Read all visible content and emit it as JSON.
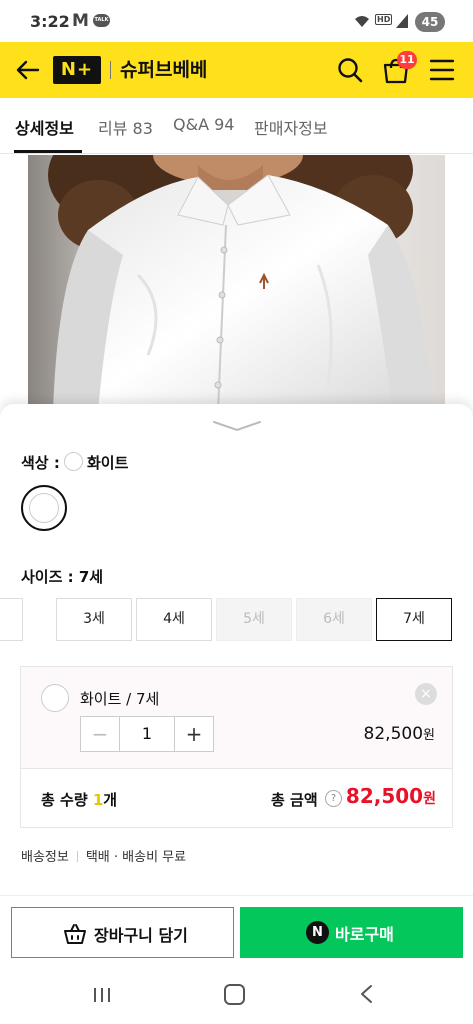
{
  "status_bar": {
    "time": "3:22",
    "mail_letter": "M",
    "talk_label": "TALK",
    "hd_label": "HD",
    "battery": "45"
  },
  "header": {
    "logo": "N+",
    "store_name": "슈퍼브베베",
    "cart_count": "11"
  },
  "tabs": [
    {
      "label": "상세정보"
    },
    {
      "label": "리뷰 83"
    },
    {
      "label": "Q&A 94"
    },
    {
      "label": "판매자정보"
    }
  ],
  "options": {
    "color_label": "색상 :",
    "color_value": "화이트",
    "size_label": "사이즈 : 7세",
    "sizes": [
      {
        "label": "",
        "state": "partial"
      },
      {
        "label": "3세",
        "state": "available"
      },
      {
        "label": "4세",
        "state": "available"
      },
      {
        "label": "5세",
        "state": "soldout"
      },
      {
        "label": "6세",
        "state": "soldout"
      },
      {
        "label": "7세",
        "state": "selected"
      }
    ]
  },
  "selection": {
    "name": "화이트 / 7세",
    "quantity": "1",
    "price": "82,500",
    "won": "원",
    "minus": "−",
    "plus": "+",
    "remove": "×"
  },
  "totals": {
    "qty_label": "총 수량",
    "qty_value": "1",
    "qty_unit": "개",
    "amount_label": "총 금액",
    "help": "?",
    "amount": "82,500",
    "won": "원"
  },
  "shipping": {
    "label": "배송정보",
    "value": "택배 · 배송비 무료"
  },
  "buttons": {
    "cart": "장바구니 담기",
    "buy": "바로구매",
    "buy_icon": "N"
  },
  "colors": {
    "header_yellow": "#ffe11b",
    "naver_green": "#03c75a",
    "price_red": "#e8132a"
  }
}
